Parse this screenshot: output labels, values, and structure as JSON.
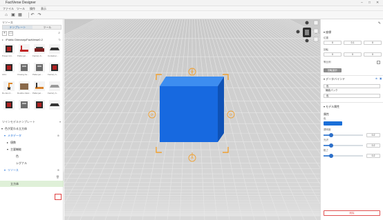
{
  "app": {
    "title": "FactVerse Designer",
    "window_controls": [
      "–",
      "□",
      "✕"
    ]
  },
  "menu": [
    "ファイル",
    "ツール",
    "操作",
    "表示"
  ],
  "toolbar": [
    {
      "icon": "home-icon",
      "glyph": "⌂"
    },
    {
      "icon": "save-icon",
      "glyph": "▣"
    },
    {
      "icon": "calendar-icon",
      "glyph": "▦"
    },
    {
      "icon": "undo-icon",
      "glyph": "↶"
    },
    {
      "icon": "redo-icon",
      "glyph": "↷"
    }
  ],
  "left": {
    "title": "リソース",
    "tabs": [
      {
        "label": "テンプレート",
        "active": true
      },
      {
        "label": "ツール",
        "active": false
      }
    ],
    "path": "/Public Directory/FactVerse0.2",
    "assets": [
      {
        "label": "Power-Gri...",
        "thumb": "dark-cube"
      },
      {
        "label": "Pallet jac...",
        "thumb": "red-jack"
      },
      {
        "label": "Factory b...",
        "thumb": "red-base"
      },
      {
        "label": "Container...",
        "thumb": "dark-tray"
      },
      {
        "label": "AGV",
        "thumb": "dark-cube"
      },
      {
        "label": "Closing-he...",
        "thumb": "grey-box"
      },
      {
        "label": "Pallet jac...",
        "thumb": "grey-box"
      },
      {
        "label": "Factory b...",
        "thumb": "dark-cube"
      },
      {
        "label": "Do-box-h...",
        "thumb": "robot-arm"
      },
      {
        "label": "Double shelv...",
        "thumb": "brown-crate"
      },
      {
        "label": "Pallet jac...",
        "thumb": "orange-jack"
      },
      {
        "label": "Factory b...",
        "thumb": "grey-plate"
      },
      {
        "label": "",
        "thumb": "dark-cube"
      },
      {
        "label": "",
        "thumb": "grey-box"
      },
      {
        "label": "",
        "thumb": "dark-cube"
      },
      {
        "label": "",
        "thumb": "dark-tray"
      }
    ],
    "twin_label": "ツインモデルテンプレート",
    "tree": [
      {
        "text": "色が変わる立方体",
        "indent": 2,
        "style": "normal",
        "arrow": "▾"
      },
      {
        "text": "メタデータ",
        "indent": 6,
        "style": "blue",
        "arrow": "▾"
      },
      {
        "text": "値数",
        "indent": 10,
        "style": "normal",
        "arrow": "▸"
      },
      {
        "text": "主要機能",
        "indent": 10,
        "style": "normal",
        "arrow": "▾"
      },
      {
        "text": "色",
        "indent": 18,
        "style": "normal",
        "arrow": ""
      },
      {
        "text": "シグナル",
        "indent": 18,
        "style": "normal",
        "arrow": ""
      },
      {
        "text": "リソース",
        "indent": 6,
        "style": "blue",
        "arrow": "▾"
      },
      {
        "text": "",
        "indent": 6,
        "style": "normal",
        "arrow": ""
      },
      {
        "text": "立方体",
        "indent": 10,
        "style": "sel",
        "arrow": ""
      }
    ],
    "context_menu": [
      "行動ツリーを追加",
      "行動ツリーを複数作成"
    ]
  },
  "right": {
    "sections": {
      "transform": "座標",
      "position": "位置",
      "rotation": "回転",
      "scale_uniform": "等比例",
      "reset_label": "回転量計",
      "data_binding": "データバインド",
      "model_props": "モデル属性"
    },
    "position_values": [
      "0",
      "0.1",
      "0"
    ],
    "rotation_values": [
      "0",
      "0",
      "0"
    ],
    "binding_fields": [
      "色",
      "機能パック",
      "色"
    ],
    "props": {
      "section": "属性",
      "color_label": "色",
      "color": "#1a6fd8",
      "sliders": [
        {
          "label": "透明度",
          "value": "0.2",
          "fraction": 0.2
        },
        {
          "label": "光沢",
          "value": "0.2",
          "fraction": 0.2
        },
        {
          "label": "粗さ",
          "value": "0.2",
          "fraction": 0.2
        }
      ]
    },
    "delete_label": "削除"
  },
  "viewport": {
    "cube_color": "#1a6fd8",
    "frame_color": "#f0a030"
  }
}
